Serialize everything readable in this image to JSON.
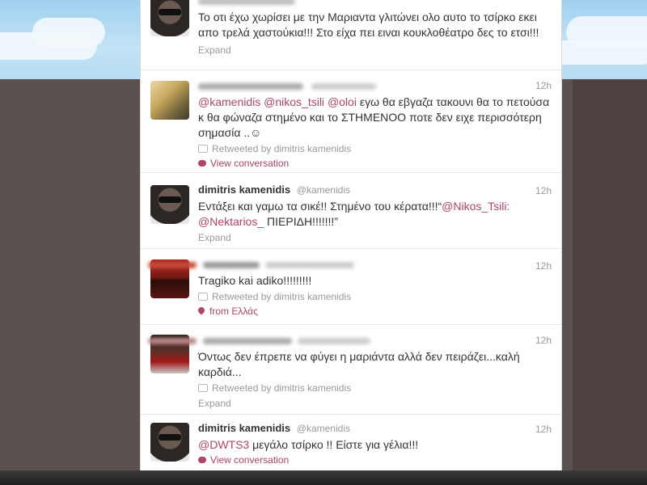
{
  "tweets": [
    {
      "avatar": "dimitris-avatar",
      "text": "Το οτι έχω χωρίσει με την Μαριαντα γλιτώνει ολο αυτο το τσίρκο εκει απο τρελά χαστούκια!!! Στο είχα πει ειναι κουκλοθέατρο δες το ετσι!!!",
      "action": "Expand"
    },
    {
      "avatar": "blonde-avatar",
      "time": "12h",
      "mentions": [
        "@kamenidis",
        "@nikos_tsili",
        "@oloi"
      ],
      "text": "εγω θα εβγαζα τακουνι θα το πετούσα κ θα φώναζα στημένο και το ΣΤΗΜΕΝΟΟ ποτε δεν ειχε περισσότερη σημασία ..☺",
      "retweeted_by": "Retweeted by dimitris kamenidis",
      "action": "View conversation"
    },
    {
      "avatar": "dimitris-avatar",
      "time": "12h",
      "name": "dimitris kamenidis",
      "handle": "@kamenidis",
      "text_before": "Εντάξει και γαμω τα σικέ!! Στημένο του κέρατα!!!“",
      "mention1": "@Nikos_Tsili:",
      "mention2": "@Nektarios_",
      "text_after": " ΠΙΕΡΙΔΗ!!!!!!!”",
      "action": "Expand"
    },
    {
      "avatar": "red-avatar",
      "time": "12h",
      "text": "Tragiko kai adiko!!!!!!!!!",
      "retweeted_by": "Retweeted by dimitris kamenidis",
      "location": "from Ελλάς"
    },
    {
      "avatar": "dark-avatar",
      "time": "12h",
      "text": "Όντως δεν έπρεπε να φύγει η μαριάντα αλλά δεν πειράζει...καλή καρδιά...",
      "retweeted_by": "Retweeted by dimitris kamenidis",
      "action": "Expand"
    },
    {
      "avatar": "dimitris-avatar",
      "time": "12h",
      "name": "dimitris kamenidis",
      "handle": "@kamenidis",
      "mention": "@DWTS3",
      "text": " μεγάλο τσίρκο !! Είστε για γέλια!!!",
      "action": "View conversation"
    }
  ],
  "colors": {
    "link": "#b24466",
    "muted": "#999999",
    "text": "#333333"
  }
}
